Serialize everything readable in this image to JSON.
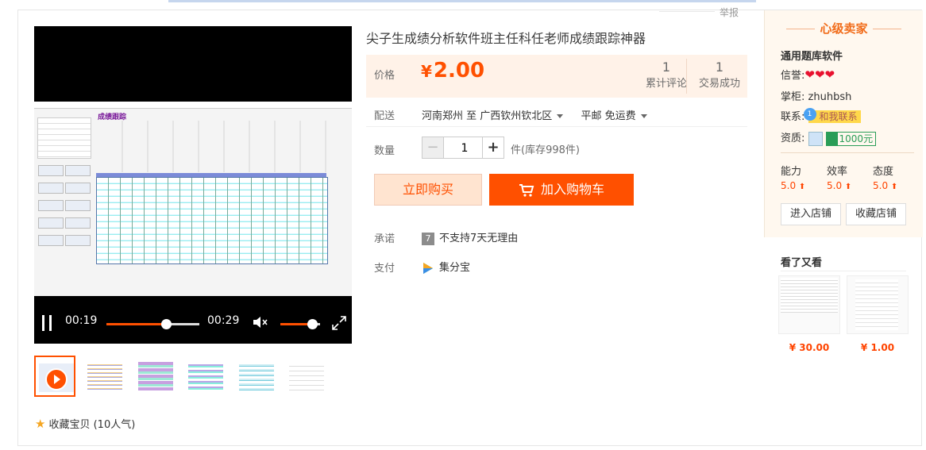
{
  "report_label": "举报",
  "product": {
    "title": "尖子生成绩分析软件班主任科任老师成绩跟踪神器",
    "price_label": "价格",
    "price_currency": "¥",
    "price_value": "2.00",
    "stats": [
      {
        "num": "1",
        "label": "累计评论"
      },
      {
        "num": "1",
        "label": "交易成功"
      }
    ],
    "shipping": {
      "label": "配送",
      "from": "河南郑州 至",
      "to": "广西钦州钦北区",
      "method": "平邮 免运费"
    },
    "quantity": {
      "label": "数量",
      "value": "1",
      "minus": "−",
      "plus": "+",
      "stock": "件(库存998件)"
    },
    "buy_now": "立即购买",
    "add_to_cart": "加入购物车",
    "promise": {
      "label": "承诺",
      "icon_text": "7",
      "text": "不支持7天无理由"
    },
    "payment": {
      "label": "支付",
      "text": "集分宝"
    }
  },
  "video": {
    "screen_title": "成绩跟踪",
    "current_time": "00:19",
    "duration": "00:29",
    "progress_fraction": 0.64,
    "volume_fraction": 0.8
  },
  "favorite": {
    "label": "收藏宝贝",
    "count": "(10人气)"
  },
  "seller": {
    "level": "心级卖家",
    "shop_name": "通用题库软件",
    "credit_label": "信誉:",
    "hearts": "❤❤❤",
    "keeper_label": "掌柜:",
    "keeper_name": "zhuhbsh",
    "contact_label": "联系:",
    "contact_btn": "和我联系",
    "contact_badge": "1",
    "quali_label": "资质:",
    "deposit": "1000元",
    "scores": [
      {
        "label": "能力",
        "value": "5.0",
        "arrow": "⬆"
      },
      {
        "label": "效率",
        "value": "5.0",
        "arrow": "⬆"
      },
      {
        "label": "态度",
        "value": "5.0",
        "arrow": "⬆"
      }
    ],
    "enter_shop": "进入店铺",
    "fav_shop": "收藏店铺"
  },
  "also_viewed": {
    "title": "看了又看",
    "items": [
      {
        "price": "¥ 30.00"
      },
      {
        "price": "¥ 1.00"
      }
    ]
  },
  "colors": {
    "accent": "#ff5000",
    "price_bg": "#fff2e8",
    "seller_bg": "#fff8ef"
  }
}
